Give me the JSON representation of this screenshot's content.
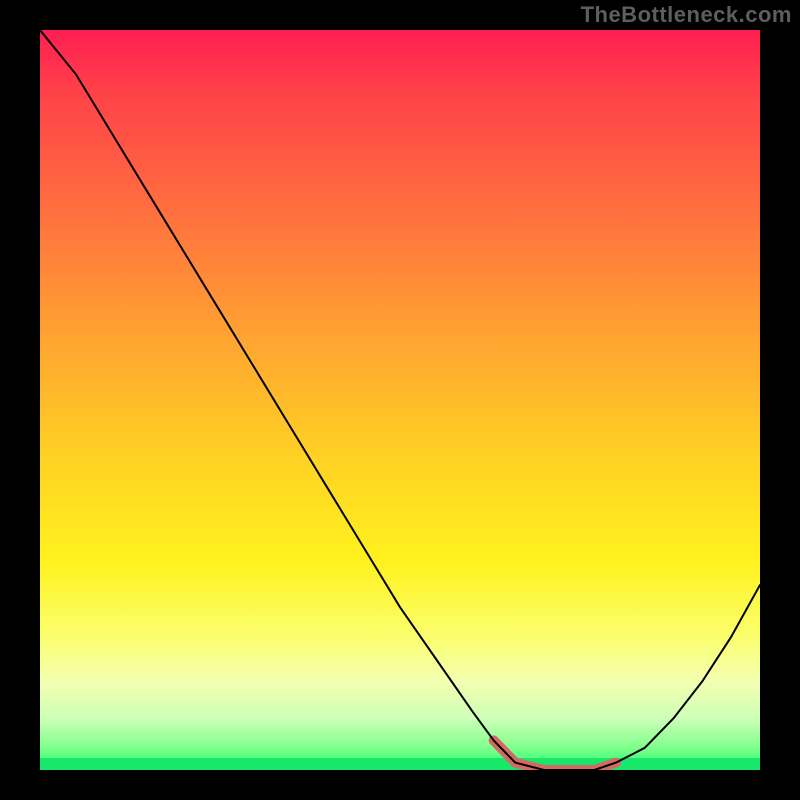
{
  "attribution": "TheBottleneck.com",
  "colors": {
    "highlight": "#d46a63",
    "curve": "#000000",
    "stage_bg": "#000000",
    "gradient": [
      "#ff1e52",
      "#ff6e3f",
      "#ffd223",
      "#fbff6e",
      "#1cff72"
    ]
  },
  "chart_data": {
    "type": "line",
    "title": "",
    "xlabel": "",
    "ylabel": "",
    "xlim": [
      0,
      100
    ],
    "ylim": [
      0,
      100
    ],
    "x": [
      0,
      5,
      10,
      15,
      20,
      25,
      30,
      35,
      40,
      45,
      50,
      55,
      60,
      63,
      66,
      70,
      74,
      77,
      80,
      84,
      88,
      92,
      96,
      100
    ],
    "values": [
      100,
      94,
      86,
      78,
      70,
      62,
      54,
      46,
      38,
      30,
      22,
      15,
      8,
      4,
      1,
      0,
      0,
      0,
      1,
      3,
      7,
      12,
      18,
      25
    ],
    "highlight_range_x": [
      63,
      80
    ],
    "annotations": []
  }
}
